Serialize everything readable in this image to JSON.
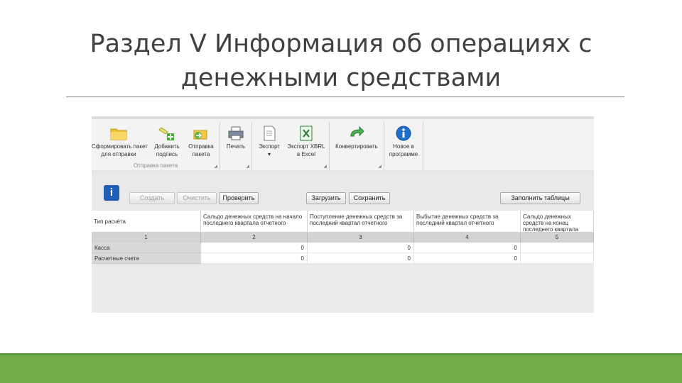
{
  "slide": {
    "title_line1": "Раздел V Информация об операциях с",
    "title_line2": "денежными средствами"
  },
  "ribbon": {
    "buttons": [
      {
        "label1": "Сформировать пакет",
        "label2": "для отправки",
        "icon": "folder-icon"
      },
      {
        "label1": "Добавить",
        "label2": "подпись",
        "icon": "sign-add-icon"
      },
      {
        "label1": "Отправка",
        "label2": "пакета",
        "icon": "send-package-icon"
      },
      {
        "label1": "Печать",
        "label2": "",
        "icon": "printer-icon"
      },
      {
        "label1": "Экспорт",
        "label2": "▾",
        "icon": "export-icon"
      },
      {
        "label1": "Экспорт XBRL",
        "label2": "в Excel",
        "icon": "excel-icon"
      },
      {
        "label1": "Конвертировать",
        "label2": "",
        "icon": "convert-arrow-icon"
      },
      {
        "label1": "Новое в",
        "label2": "программе",
        "icon": "info-icon"
      }
    ],
    "group_caption": "Отправка пакета",
    "splitter": "....",
    "colors": {
      "folder": "#f0c030",
      "accent_green": "#70ad47",
      "info_blue": "#1f5fb8"
    }
  },
  "toolbar": {
    "create": "Создать",
    "clear": "Очистить",
    "check": "Проверить",
    "load": "Загрузить",
    "save": "Сохранить",
    "fill_table": "Заполнить таблицы"
  },
  "table": {
    "headers": [
      "Тип расчёта",
      "Сальдо денежных средств на начало последнего квартала отчетного",
      "Поступление денежных средств за последний квартал отчетного",
      "Выбытие денежных средств за последний квартал отчетного",
      "Сальдо денежных средств на конец последнего квартала отчетного"
    ],
    "numbers": [
      "1",
      "2",
      "3",
      "4",
      "5"
    ],
    "rows": [
      {
        "label": "Касса",
        "values": [
          "0",
          "0",
          "0",
          ""
        ]
      },
      {
        "label": "Расчетные счета",
        "values": [
          "0",
          "0",
          "0",
          ""
        ]
      }
    ]
  }
}
